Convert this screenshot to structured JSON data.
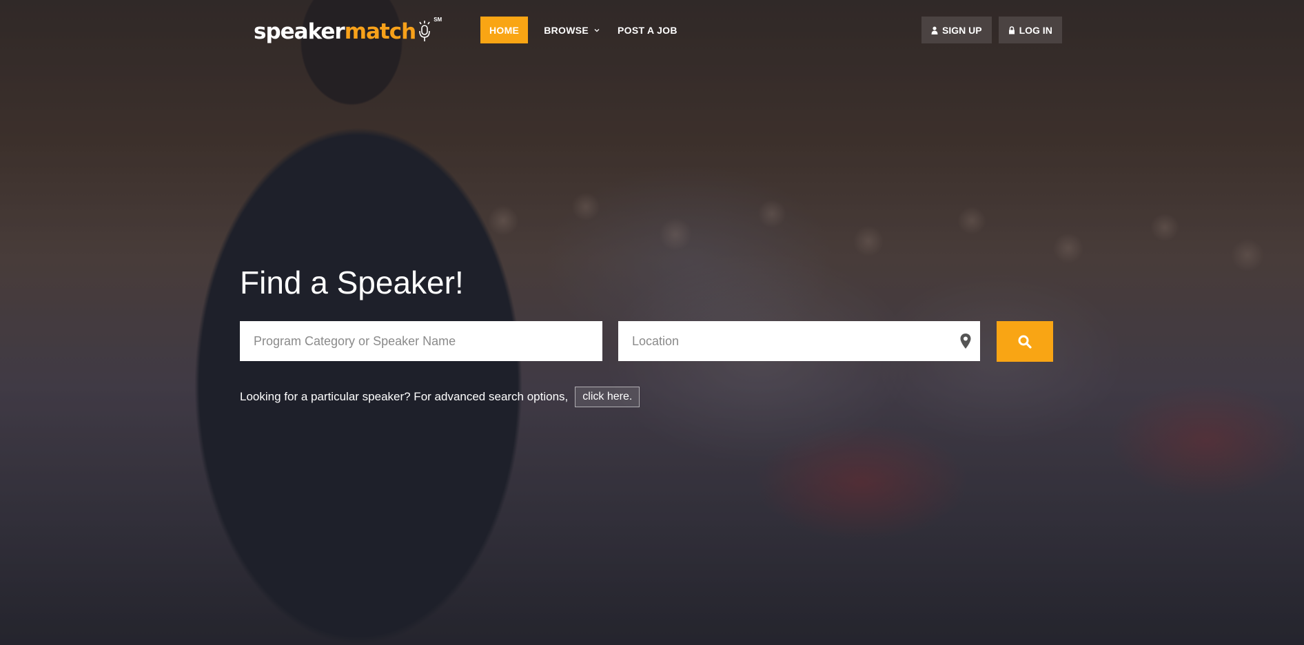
{
  "logo": {
    "part1": "speaker",
    "part2": "match",
    "service_mark": "SM"
  },
  "nav": {
    "items": [
      {
        "label": "HOME"
      },
      {
        "label": "BROWSE"
      },
      {
        "label": "POST A JOB"
      }
    ]
  },
  "auth": {
    "signup_label": "SIGN UP",
    "login_label": "LOG IN"
  },
  "hero": {
    "title": "Find a Speaker!",
    "search_placeholder": "Program Category or Speaker Name",
    "location_placeholder": "Location",
    "advanced_text": "Looking for a particular speaker? For advanced search options,",
    "advanced_link": "click here."
  },
  "icons": {
    "user": "user-icon",
    "lock": "lock-icon",
    "map_marker": "map-marker-icon",
    "search": "search-icon",
    "chevron": "chevron-down-icon"
  },
  "colors": {
    "accent": "#f9a514",
    "logo_orange": "#f7a11a",
    "auth_bg": "#504846"
  }
}
